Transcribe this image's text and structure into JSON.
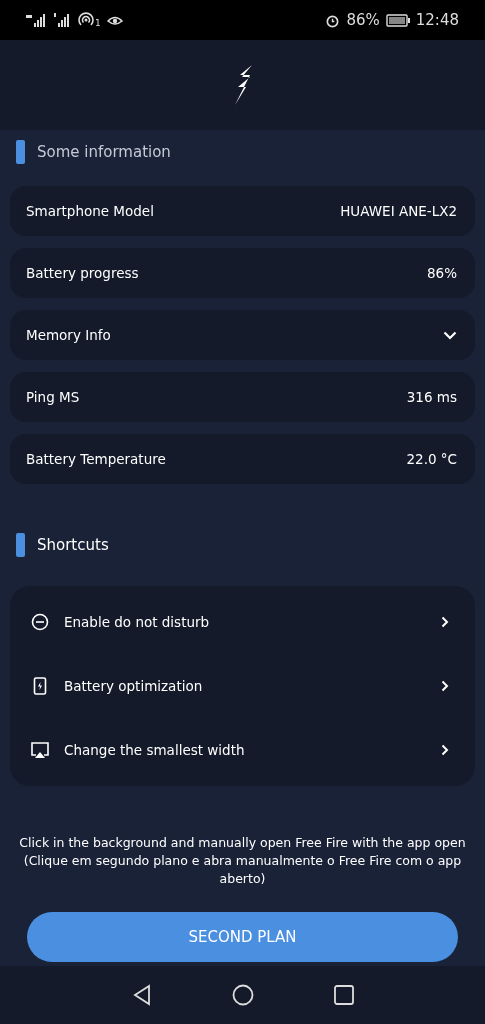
{
  "status_bar": {
    "hotspot_count": "1",
    "battery_percent": "86%",
    "time": "12:48"
  },
  "info_section": {
    "title": "Some information",
    "rows": [
      {
        "kind": "value",
        "label": "Smartphone Model",
        "value": "HUAWEI ANE-LX2"
      },
      {
        "kind": "value",
        "label": "Battery progress",
        "value": "86%"
      },
      {
        "kind": "expandable",
        "label": "Memory Info",
        "expanded": false
      },
      {
        "kind": "value",
        "label": "Ping MS",
        "value": "316 ms"
      },
      {
        "kind": "value",
        "label": "Battery Temperature",
        "value": "22.0 °C"
      }
    ]
  },
  "shortcuts_section": {
    "title": "Shortcuts",
    "items": [
      {
        "kind": "dnd",
        "label": "Enable do not disturb"
      },
      {
        "kind": "battery",
        "label": "Battery optimization"
      },
      {
        "kind": "screen",
        "label": "Change the smallest width"
      }
    ]
  },
  "hint": "Click in the background and manually open Free Fire with the app open (Clique em segundo plano e abra manualmente o Free Fire com o app aberto)",
  "primary_button": "SECOND PLAN"
}
